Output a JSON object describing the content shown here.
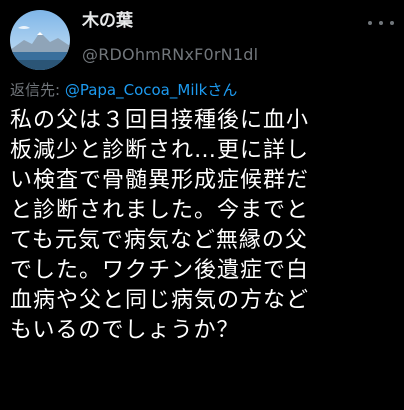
{
  "author": {
    "display_name": "木の葉",
    "handle": "@RDOhmRNxF0rN1dl",
    "avatar_icon": "avatar-mountain-sea-photo"
  },
  "more_icon": "more-dots-icon",
  "reply": {
    "prefix": "返信先: ",
    "target": "@Papa_Cocoa_Milkさん"
  },
  "tweet_lines": [
    "私の父は３回目接種後に血小",
    "板減少と診断され…更に詳し",
    "い検査で骨髄異形成症候群だ",
    "と診断されました。今までと",
    "ても元気で病気など無縁の父",
    "でした。ワクチン後遺症で白",
    "血病や父と同じ病気の方など",
    "もいるのでしょうか？"
  ],
  "colors": {
    "background": "#000000",
    "text": "#ffffff",
    "muted": "#71767b",
    "link": "#1d9bf0"
  }
}
